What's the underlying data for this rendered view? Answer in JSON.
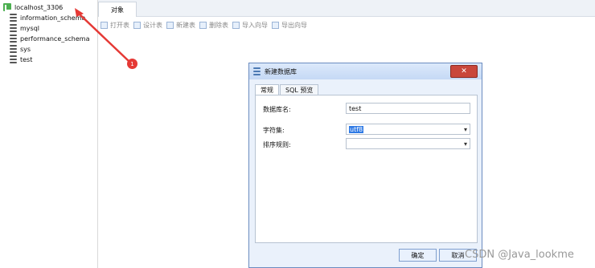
{
  "sidebar": {
    "connection": "localhost_3306",
    "databases": [
      "information_schema",
      "mysql",
      "performance_schema",
      "sys",
      "test"
    ]
  },
  "tabs": [
    "对象"
  ],
  "toolbar": [
    "打开表",
    "设计表",
    "新建表",
    "删除表",
    "导入向导",
    "导出向导"
  ],
  "annotation": {
    "badge": "1"
  },
  "dialog": {
    "title": "新建数据库",
    "tabs": [
      "常规",
      "SQL 预览"
    ],
    "fields": {
      "db_name_label": "数据库名:",
      "db_name_value": "test",
      "charset_label": "字符集:",
      "charset_value": "utf8",
      "collation_label": "排序规则:",
      "collation_value": ""
    },
    "buttons": {
      "ok": "确定",
      "cancel": "取消"
    }
  },
  "watermark": "CSDN @Java_lookme"
}
